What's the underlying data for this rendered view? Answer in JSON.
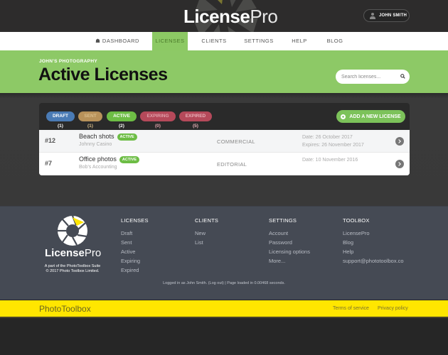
{
  "header": {
    "brand_bold": "License",
    "brand_light": "Pro",
    "user_name": "JOHN SMITH"
  },
  "nav": {
    "items": [
      {
        "label": "DASHBOARD",
        "icon": "home-icon"
      },
      {
        "label": "LICENSES",
        "active": true
      },
      {
        "label": "CLIENTS"
      },
      {
        "label": "SETTINGS"
      },
      {
        "label": "HELP"
      },
      {
        "label": "BLOG"
      }
    ]
  },
  "hero": {
    "breadcrumb": "JOHN'S PHOTOGRAPHY",
    "title": "Active Licenses",
    "search_placeholder": "Search licenses...",
    "accent": "#8dc966"
  },
  "filters": [
    {
      "label": "DRAFT (1)",
      "color": "#4a7bb5"
    },
    {
      "label": "SENT (1)",
      "color": "#b8925a"
    },
    {
      "label": "ACTIVE (2)",
      "color": "#6dbd45"
    },
    {
      "label": "EXPIRING (0)",
      "color": "#b5495a"
    },
    {
      "label": "EXPIRED (5)",
      "color": "#b5495a"
    }
  ],
  "add_button": "ADD A NEW LICENSE",
  "licenses": [
    {
      "number": "#12",
      "title": "Beach shots",
      "status": "ACTIVE",
      "client": "Johnny Casino",
      "type": "COMMERCIAL",
      "date": "Date: 26 October 2017",
      "expires": "Expires: 26 November 2017"
    },
    {
      "number": "#7",
      "title": "Office photos",
      "status": "ACTIVE",
      "client": "Bob's Accounting",
      "type": "EDITORIAL",
      "date": "Date: 10 November 2016",
      "expires": ""
    }
  ],
  "footer": {
    "brand_bold": "License",
    "brand_light": "Pro",
    "suite_line1": "A part of the PhotoToolbox Suite",
    "suite_line2": "© 2017 Photo Toolbox Limited.",
    "columns": [
      {
        "heading": "LICENSES",
        "links": [
          "Draft",
          "Sent",
          "Active",
          "Expiring",
          "Expired"
        ]
      },
      {
        "heading": "CLIENTS",
        "links": [
          "New",
          "List"
        ]
      },
      {
        "heading": "SETTINGS",
        "links": [
          "Account",
          "Password",
          "Licensing options",
          "More..."
        ]
      },
      {
        "heading": "TOOLBOX",
        "links": [
          "LicensePro",
          "Blog",
          "Help",
          "support@phototoolbox.co"
        ]
      }
    ],
    "status": "Logged in as John Smith. (Log out) | Page loaded in 0.00468 seconds."
  },
  "bottom_bar": {
    "brand": "PhotoToolbox",
    "terms": "Terms of service",
    "privacy": "Privacy policy",
    "color": "#ffe600"
  }
}
